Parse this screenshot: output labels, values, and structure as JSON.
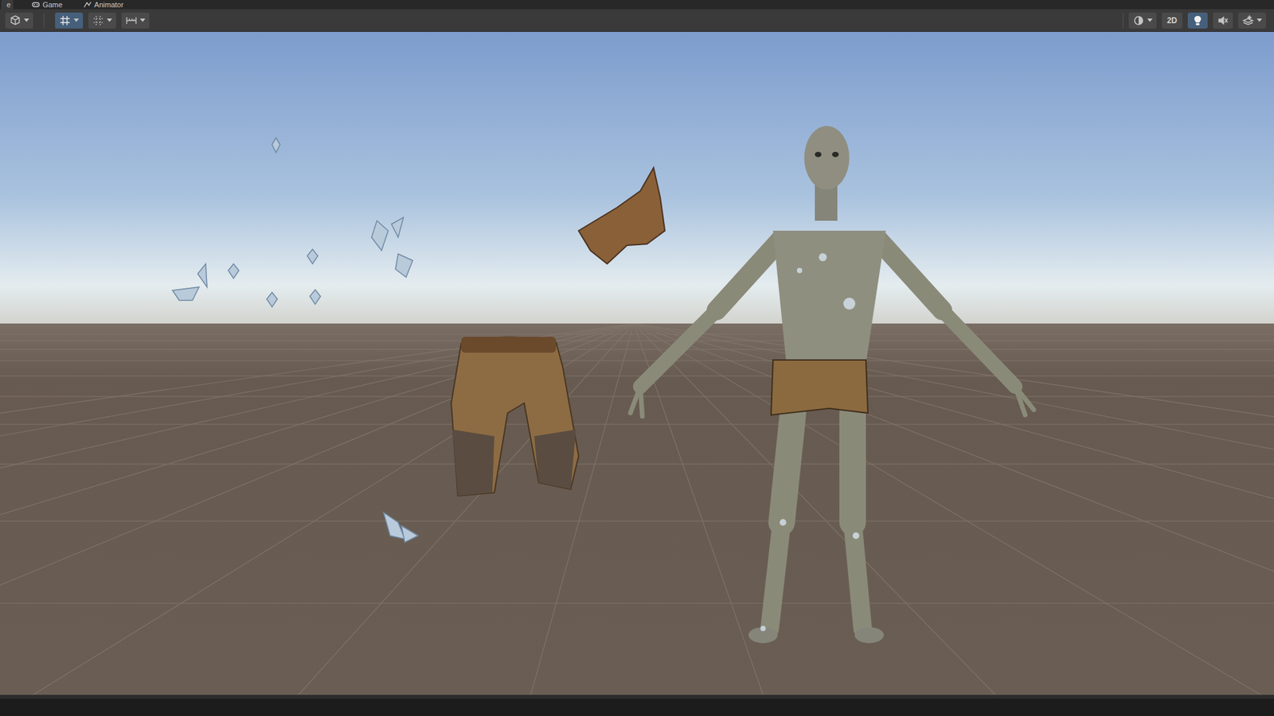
{
  "tabs": [
    {
      "label": "e",
      "kind": "scene",
      "selected": true
    },
    {
      "label": "Game",
      "kind": "game",
      "selected": false
    },
    {
      "label": "Animator",
      "kind": "animator",
      "selected": false
    }
  ],
  "toolbar": {
    "left": [
      {
        "kind": "cube",
        "selected": false,
        "dropdown": true
      },
      {
        "kind": "grid-snap",
        "selected": true,
        "dropdown": true
      },
      {
        "kind": "increment-snap",
        "selected": false,
        "dropdown": true
      },
      {
        "kind": "ruler",
        "selected": false,
        "dropdown": true
      }
    ],
    "right": [
      {
        "kind": "shading",
        "selected": false,
        "dropdown": true
      },
      {
        "kind": "label",
        "label": "2D",
        "selected": false,
        "dropdown": false
      },
      {
        "kind": "lighting",
        "selected": true,
        "dropdown": false
      },
      {
        "kind": "audio",
        "selected": false,
        "dropdown": false
      },
      {
        "kind": "effects",
        "selected": false,
        "dropdown": true
      }
    ]
  }
}
